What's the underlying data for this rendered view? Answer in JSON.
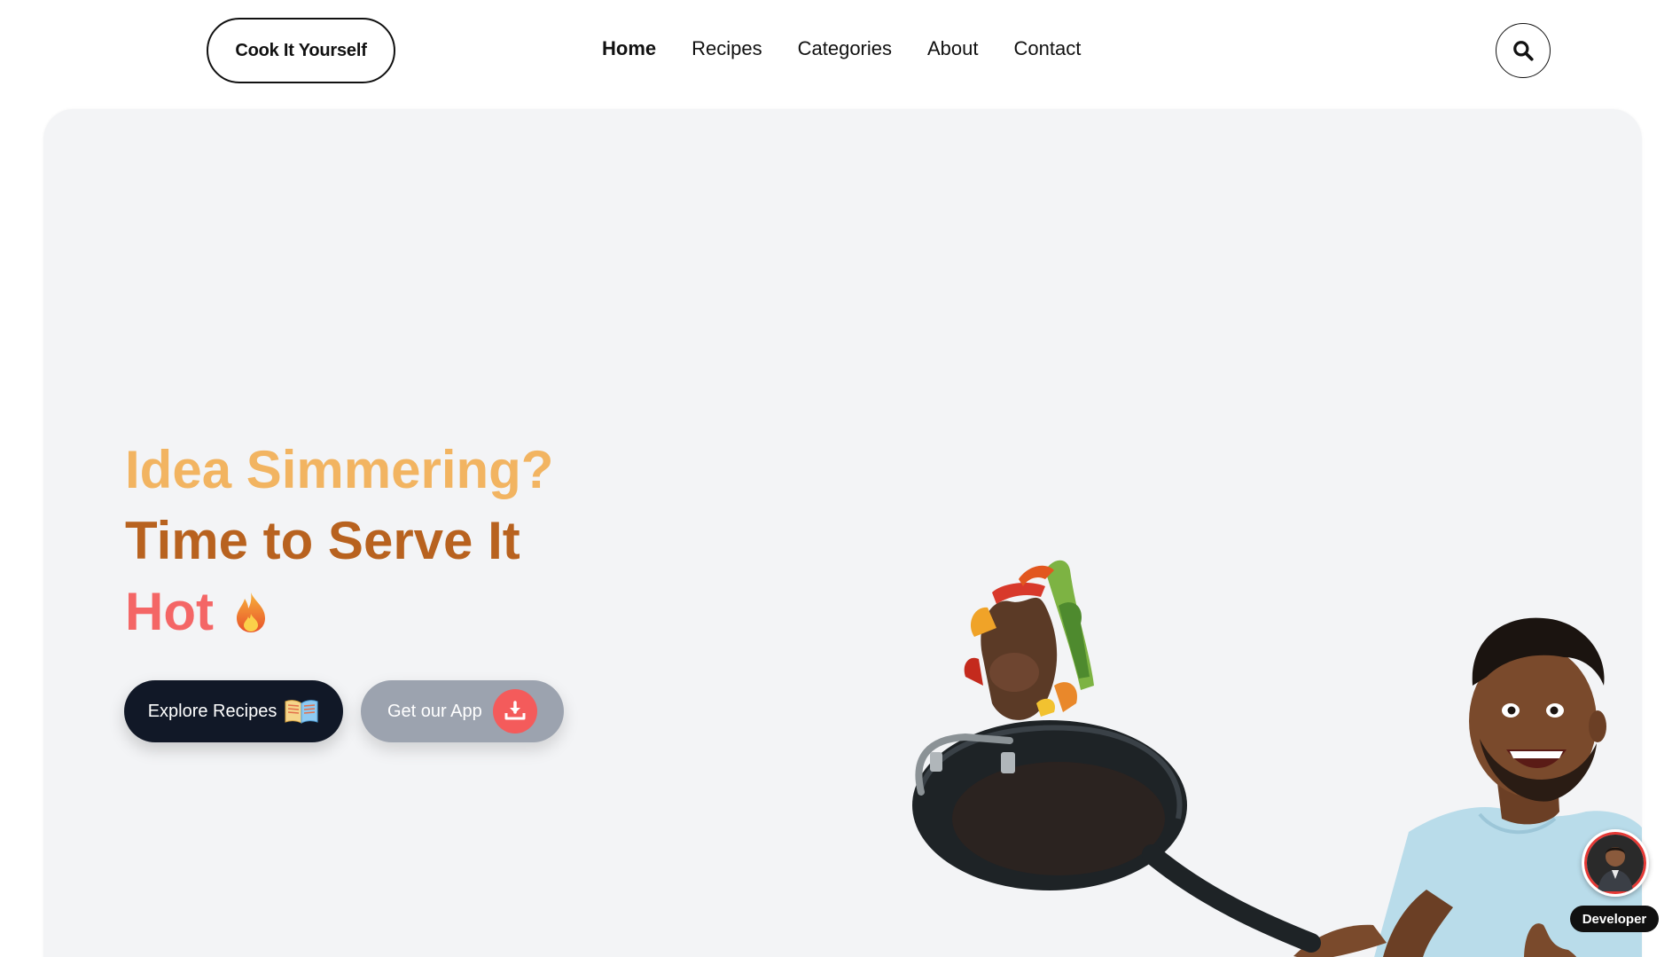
{
  "header": {
    "logo_label": "Cook It Yourself",
    "nav": [
      {
        "label": "Home",
        "active": true
      },
      {
        "label": "Recipes",
        "active": false
      },
      {
        "label": "Categories",
        "active": false
      },
      {
        "label": "About",
        "active": false
      },
      {
        "label": "Contact",
        "active": false
      }
    ],
    "search_icon": "search-icon"
  },
  "hero": {
    "line1": "Idea Simmering?",
    "line2": "Time to Serve It",
    "line3": "Hot",
    "line3_icon": "fire-icon",
    "explore_button": "Explore Recipes",
    "explore_icon": "open-book-icon",
    "app_button": "Get our App",
    "app_icon": "download-icon",
    "illustration": "chef-flipping-pan-illustration"
  },
  "floating": {
    "developer_label": "Developer",
    "avatar_icon": "developer-avatar"
  },
  "colors": {
    "line1": "#f2b461",
    "line2": "#b8621f",
    "line3": "#f46666",
    "explore_bg": "#111827",
    "app_bg": "#9ca3af",
    "download_accent": "#f45b5b",
    "hero_bg": "#f3f4f6"
  }
}
